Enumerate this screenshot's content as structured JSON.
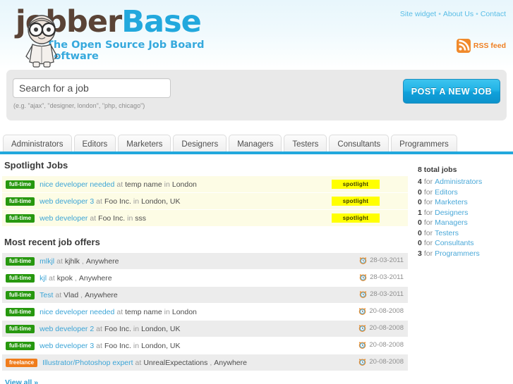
{
  "header": {
    "logo_primary": "jobber",
    "logo_secondary": "Base",
    "tagline": "The Open Source Job Board Software",
    "topnav": [
      {
        "label": "Site widget",
        "name": "site-widget"
      },
      {
        "label": "About Us",
        "name": "about-us"
      },
      {
        "label": "Contact",
        "name": "contact"
      }
    ],
    "topnav_separator": "•",
    "rss_label": "RSS feed",
    "colors": {
      "logo_brown": "#5a4336",
      "logo_blue": "#22a8dd",
      "accent": "#22a8dd",
      "rss_orange": "#ef7f21"
    }
  },
  "search": {
    "value": "Search for a job",
    "placeholder": "Search for a job",
    "hint": "(e.g. \"ajax\", \"designer, london\", \"php, chicago\")",
    "post_button": "POST A NEW JOB"
  },
  "tabs": [
    {
      "label": "Administrators",
      "name": "tab-administrators"
    },
    {
      "label": "Editors",
      "name": "tab-editors"
    },
    {
      "label": "Marketers",
      "name": "tab-marketers"
    },
    {
      "label": "Designers",
      "name": "tab-designers"
    },
    {
      "label": "Managers",
      "name": "tab-managers"
    },
    {
      "label": "Testers",
      "name": "tab-testers"
    },
    {
      "label": "Consultants",
      "name": "tab-consultants"
    },
    {
      "label": "Programmers",
      "name": "tab-programmers"
    }
  ],
  "spotlight": {
    "title": "Spotlight Jobs",
    "tag_label": "spotlight",
    "jobs": [
      {
        "type": "full-time",
        "title": "nice developer needed",
        "at": "at",
        "company": "temp name",
        "in": "in",
        "location": "London"
      },
      {
        "type": "full-time",
        "title": "web developer 3",
        "at": "at",
        "company": "Foo Inc.",
        "in": "in",
        "location": "London, UK"
      },
      {
        "type": "full-time",
        "title": "web developer",
        "at": "at",
        "company": "Foo Inc.",
        "in": "in",
        "location": "sss"
      }
    ]
  },
  "recent": {
    "title": "Most recent job offers",
    "view_all": "View all »",
    "jobs": [
      {
        "type": "full-time",
        "title": "mlkjl",
        "at": "at",
        "company": "kjhlk",
        "in": ",",
        "location": "Anywhere",
        "date": "28-03-2011"
      },
      {
        "type": "full-time",
        "title": "kjl",
        "at": "at",
        "company": "kpok",
        "in": ",",
        "location": "Anywhere",
        "date": "28-03-2011"
      },
      {
        "type": "full-time",
        "title": "Test",
        "at": "at",
        "company": "Vlad",
        "in": ",",
        "location": "Anywhere",
        "date": "28-03-2011"
      },
      {
        "type": "full-time",
        "title": "nice developer needed",
        "at": "at",
        "company": "temp name",
        "in": "in",
        "location": "London",
        "date": "20-08-2008"
      },
      {
        "type": "full-time",
        "title": "web developer 2",
        "at": "at",
        "company": "Foo Inc.",
        "in": "in",
        "location": "London, UK",
        "date": "20-08-2008"
      },
      {
        "type": "full-time",
        "title": "web developer 3",
        "at": "at",
        "company": "Foo Inc.",
        "in": "in",
        "location": "London, UK",
        "date": "20-08-2008"
      },
      {
        "type": "freelance",
        "title": "Illustrator/Photoshop expert",
        "at": "at",
        "company": "UnrealExpectations",
        "in": ",",
        "location": "Anywhere",
        "date": "20-08-2008"
      }
    ]
  },
  "sidebar": {
    "total": "8 total jobs",
    "for_label": "for",
    "stats": [
      {
        "count": "4",
        "category": "Administrators"
      },
      {
        "count": "0",
        "category": "Editors"
      },
      {
        "count": "0",
        "category": "Marketers"
      },
      {
        "count": "1",
        "category": "Designers"
      },
      {
        "count": "0",
        "category": "Managers"
      },
      {
        "count": "0",
        "category": "Testers"
      },
      {
        "count": "0",
        "category": "Consultants"
      },
      {
        "count": "3",
        "category": "Programmers"
      }
    ]
  }
}
